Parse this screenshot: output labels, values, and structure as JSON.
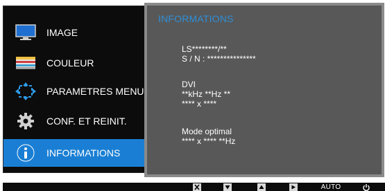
{
  "menu": {
    "items": [
      {
        "label": "IMAGE",
        "icon": "monitor-icon"
      },
      {
        "label": "COULEUR",
        "icon": "color-bars-icon"
      },
      {
        "label": "PARAMETRES MENU",
        "icon": "resize-arrows-icon"
      },
      {
        "label": "CONF. ET REINIT.",
        "icon": "gear-icon"
      },
      {
        "label": "INFORMATIONS",
        "icon": "info-icon"
      }
    ],
    "selected_index": 4
  },
  "info": {
    "title": "INFORMATIONS",
    "model": "LS********/**",
    "serial": "S / N : ***************",
    "input": "DVI",
    "frequency": "**kHz **Hz **",
    "resolution": "**** x ****",
    "optimal_label": "Mode optimal",
    "optimal_value": "**** x **** **Hz"
  },
  "buttons": {
    "close": "close-icon",
    "down": "down-arrow-icon",
    "up": "up-arrow-icon",
    "enter": "enter-icon",
    "auto_label": "AUTO",
    "power": "power-icon"
  },
  "colors": {
    "accent": "#1a7fd4",
    "title": "#2f8ed8",
    "panel": "#585858",
    "menu_bg": "#0c0c0c"
  }
}
